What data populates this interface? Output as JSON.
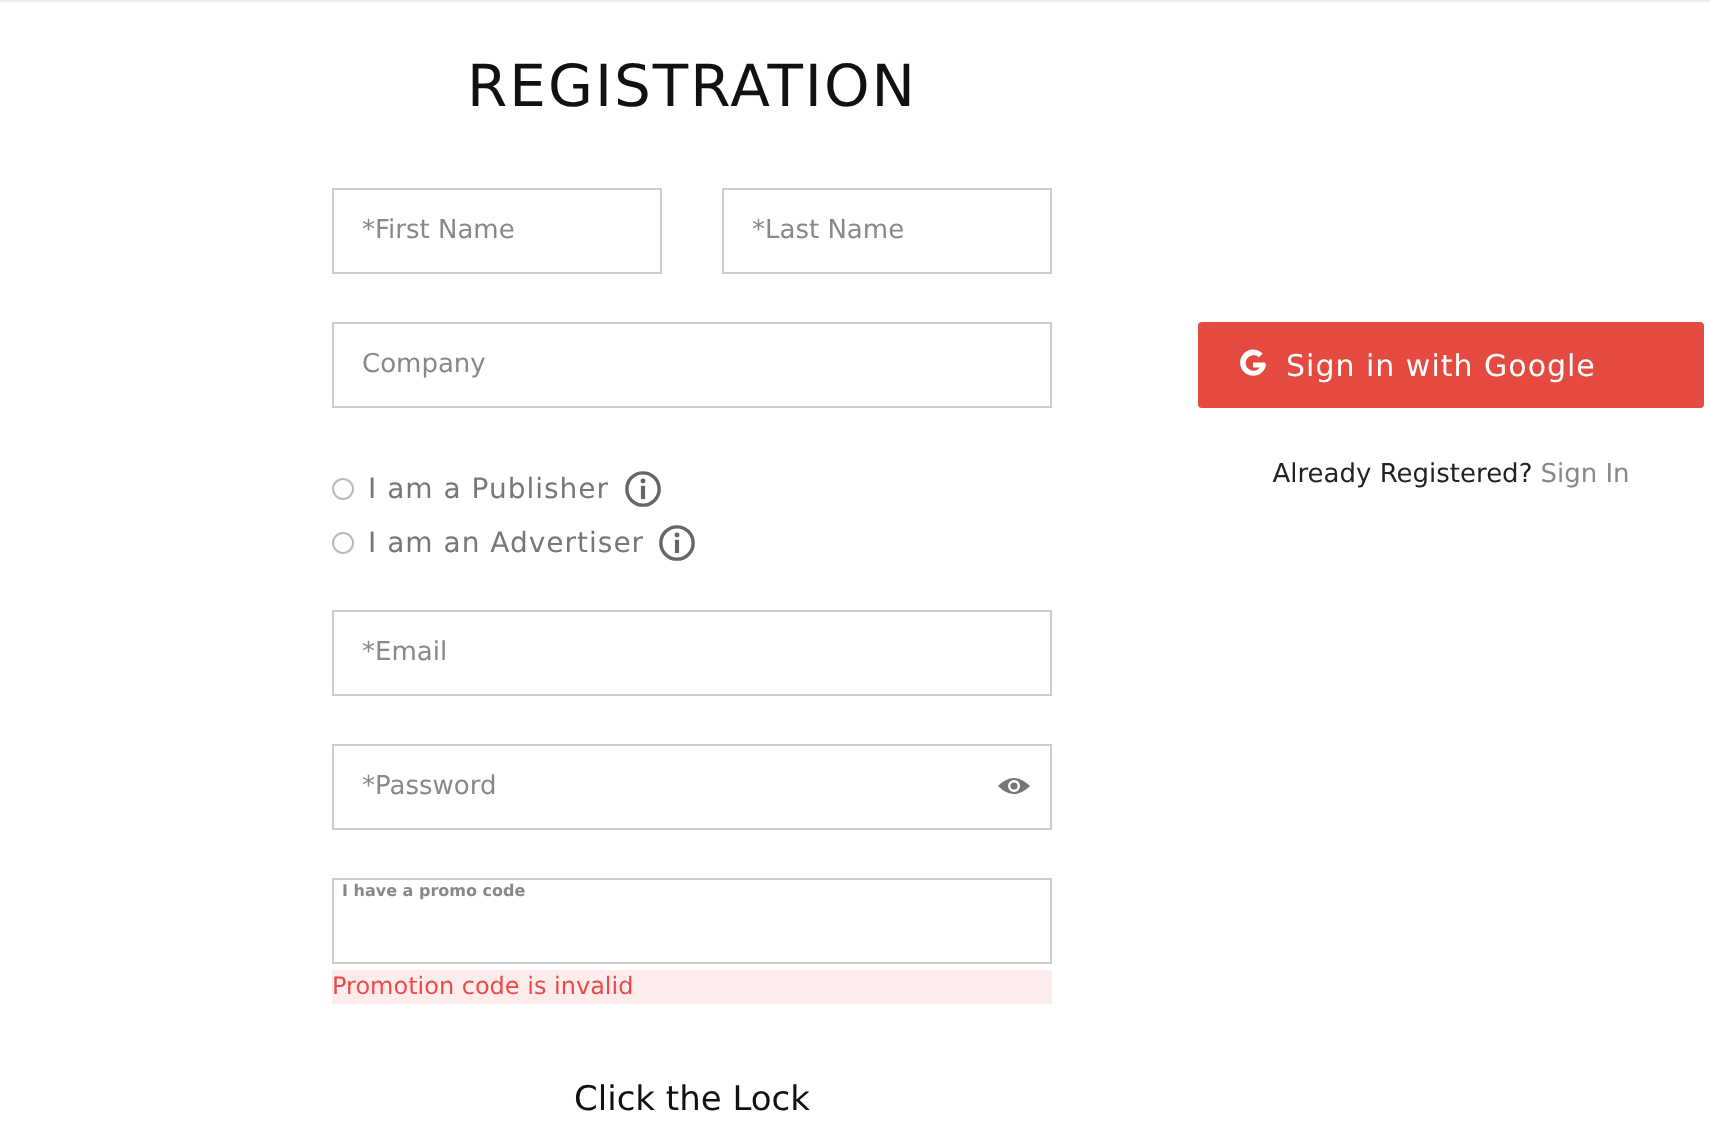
{
  "title": "REGISTRATION",
  "name_fields": [
    {
      "placeholder": "*First Name"
    },
    {
      "placeholder": "*Last Name"
    }
  ],
  "company": {
    "placeholder": "Company"
  },
  "roles": [
    {
      "label": "I am a Publisher",
      "selected": false
    },
    {
      "label": "I am an Advertiser",
      "selected": false
    }
  ],
  "email": {
    "placeholder": "*Email"
  },
  "password": {
    "placeholder": "*Password"
  },
  "promo": {
    "label": "I have a promo code",
    "error": "Promotion code is invalid"
  },
  "lock_caption": "Click the Lock",
  "google_button": "Sign in with Google",
  "already_registered": "Already Registered?",
  "sign_in_link": "Sign In"
}
